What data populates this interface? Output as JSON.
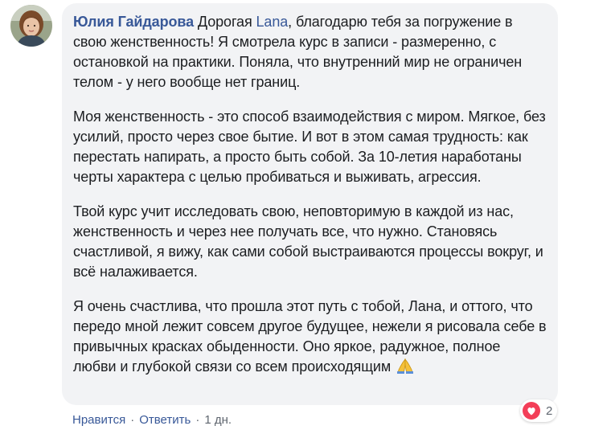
{
  "comment": {
    "author": "Юлия Гайдарова",
    "mention": "Lana",
    "intro_before_mention": " Дорогая ",
    "intro_after_mention": ", благодарю тебя за погружение в свою женственность! Я смотрела курс в записи - размеренно, с остановкой на практики. Поняла, что внутренний мир не ограничен телом - у него вообще нет границ.",
    "paragraph2": "Моя женственность - это способ взаимодействия с миром. Мягкое, без усилий, просто через свое бытие. И вот в этом самая трудность: как перестать напирать, а просто быть собой. За 10-летия наработаны черты характера с целью пробиваться и выживать, агрессия.",
    "paragraph3": "Твой курс учит исследовать свою, неповторимую в каждой из нас, женственность и через нее получать все, что нужно. Становясь счастливой, я вижу, как сами собой выстраиваются процессы вокруг, и всё налаживается.",
    "paragraph4": "Я очень счастлива, что прошла этот путь с тобой, Лана, и оттого, что передо мной лежит совсем другое будущее, нежели я рисовала себе в привычных красках обыденности. Оно яркое, радужное, полное любви и глубокой связи со всем происходящим",
    "emoji": "folded-hands"
  },
  "reactions": {
    "icon": "heart-icon",
    "count": "2",
    "color": "#f33e58"
  },
  "actions": {
    "like": "Нравится",
    "reply": "Ответить",
    "separator": "·",
    "time": "1 дн."
  },
  "colors": {
    "bubble": "#f2f3f5",
    "link": "#385898",
    "text": "#1c1e21",
    "meta": "#606770"
  }
}
